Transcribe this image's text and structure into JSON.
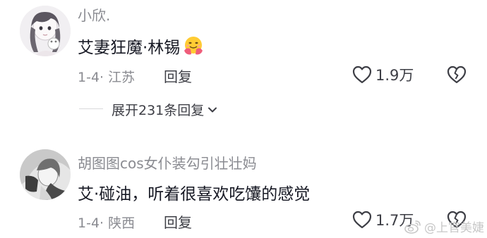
{
  "comments": [
    {
      "username": "小欣.",
      "content": "艾妻狂魔·林锡",
      "emoji": "hugging-face-emoji",
      "date": "1-4",
      "location": "江苏",
      "reply_label": "回复",
      "likes": "1.9万",
      "expand_label": "展开231条回复"
    },
    {
      "username": "胡图图cos女仆装勾引壮壮妈",
      "content": "艾·碰油，听着很喜欢吃馕的感觉",
      "date": "1-4",
      "location": "陕西",
      "reply_label": "回复",
      "likes": "1.7万"
    }
  ],
  "watermark": {
    "text": "@上官美婕",
    "icon": "weibo-logo-icon"
  },
  "colors": {
    "text_primary": "#161823",
    "text_secondary": "#8a8b91",
    "divider": "#d8d8da"
  }
}
